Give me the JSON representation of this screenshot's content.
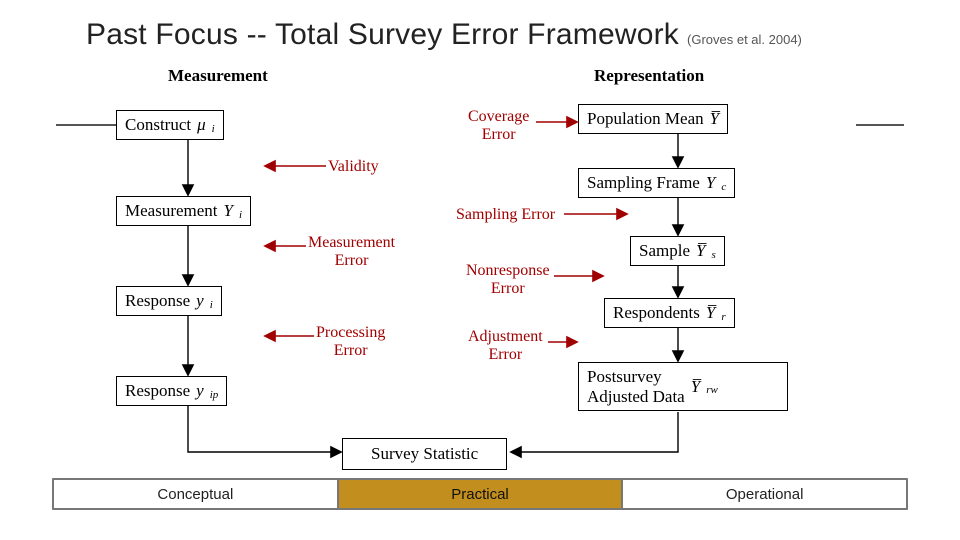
{
  "title": {
    "main": "Past Focus -- Total Survey Error Framework",
    "citation": "(Groves et al. 2004)"
  },
  "columns": {
    "left_header": "Measurement",
    "right_header": "Representation"
  },
  "left_boxes": {
    "construct": {
      "label": "Construct",
      "sym": "μ",
      "sub": "i"
    },
    "measurement": {
      "label": "Measurement",
      "sym": "Y",
      "sub": "i"
    },
    "response": {
      "label": "Response",
      "sym": "y",
      "sub": "i"
    },
    "response_proc": {
      "label": "Response",
      "sym": "y",
      "sub": "ip"
    }
  },
  "right_boxes": {
    "pop_mean": {
      "label": "Population Mean",
      "sym": "Y̅",
      "sub": ""
    },
    "frame": {
      "label": "Sampling Frame",
      "sym": "Y",
      "sub": "c"
    },
    "sample": {
      "label": "Sample",
      "sym": "Y̅",
      "sub": "s"
    },
    "respondents": {
      "label": "Respondents",
      "sym": "Y̅",
      "sub": "r"
    },
    "postadj": {
      "label": "Postsurvey\nAdjusted Data",
      "sym": "Y̅",
      "sub": "rw"
    }
  },
  "errors": {
    "validity": "Validity",
    "meas_err": "Measurement\nError",
    "proc_err": "Processing\nError",
    "cov_err": "Coverage\nError",
    "samp_err": "Sampling Error",
    "nonresp_err": "Nonresponse\nError",
    "adj_err": "Adjustment\nError"
  },
  "survey_stat": "Survey Statistic",
  "tabs": {
    "conceptual": "Conceptual",
    "practical": "Practical",
    "operational": "Operational"
  }
}
